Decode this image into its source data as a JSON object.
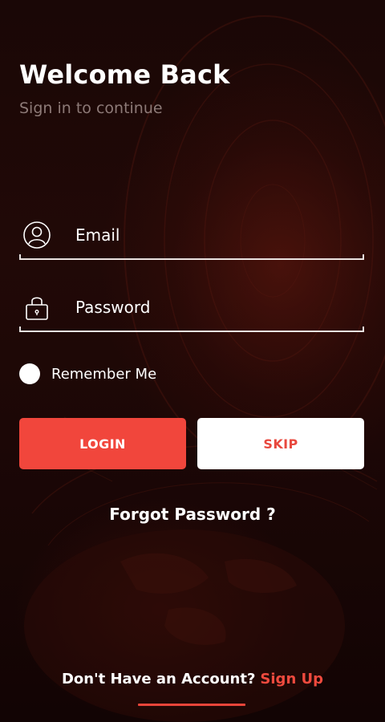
{
  "header": {
    "title": "Welcome Back",
    "subtitle": "Sign in to continue"
  },
  "form": {
    "email": {
      "placeholder": "Email",
      "value": "",
      "icon": "user-circle-icon"
    },
    "password": {
      "placeholder": "Password",
      "value": "",
      "icon": "padlock-icon"
    },
    "remember_label": "Remember Me",
    "remember_checked": false
  },
  "actions": {
    "login_label": "LOGIN",
    "skip_label": "SKIP",
    "forgot_label": "Forgot Password ?"
  },
  "footer": {
    "prompt": "Don't Have an Account?",
    "signup_label": "Sign Up"
  },
  "colors": {
    "accent": "#f1463c",
    "background": "#1a0706",
    "subtitle_text": "#8d7a77",
    "field_line": "#e9e2e0"
  }
}
